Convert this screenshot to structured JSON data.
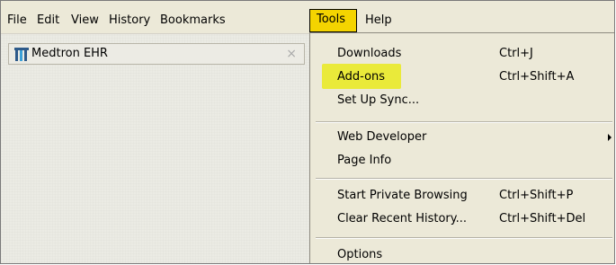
{
  "menubar": {
    "file": "File",
    "edit": "Edit",
    "view": "View",
    "history": "History",
    "bookmarks": "Bookmarks",
    "tools": "Tools",
    "help": "Help"
  },
  "tab": {
    "title": "Medtron EHR",
    "close": "×"
  },
  "tools_menu": {
    "downloads": {
      "label": "Downloads",
      "shortcut": "Ctrl+J"
    },
    "addons": {
      "label": "Add-ons",
      "shortcut": "Ctrl+Shift+A"
    },
    "setup_sync": {
      "label": "Set Up Sync..."
    },
    "web_developer": {
      "label": "Web Developer"
    },
    "page_info": {
      "label": "Page Info"
    },
    "private_browsing": {
      "label": "Start Private Browsing",
      "shortcut": "Ctrl+Shift+P"
    },
    "clear_history": {
      "label": "Clear Recent History...",
      "shortcut": "Ctrl+Shift+Del"
    },
    "options": {
      "label": "Options"
    }
  },
  "colors": {
    "highlight": "#eaea3a",
    "tools_active": "#f4d400",
    "chrome": "#ece9d8"
  }
}
